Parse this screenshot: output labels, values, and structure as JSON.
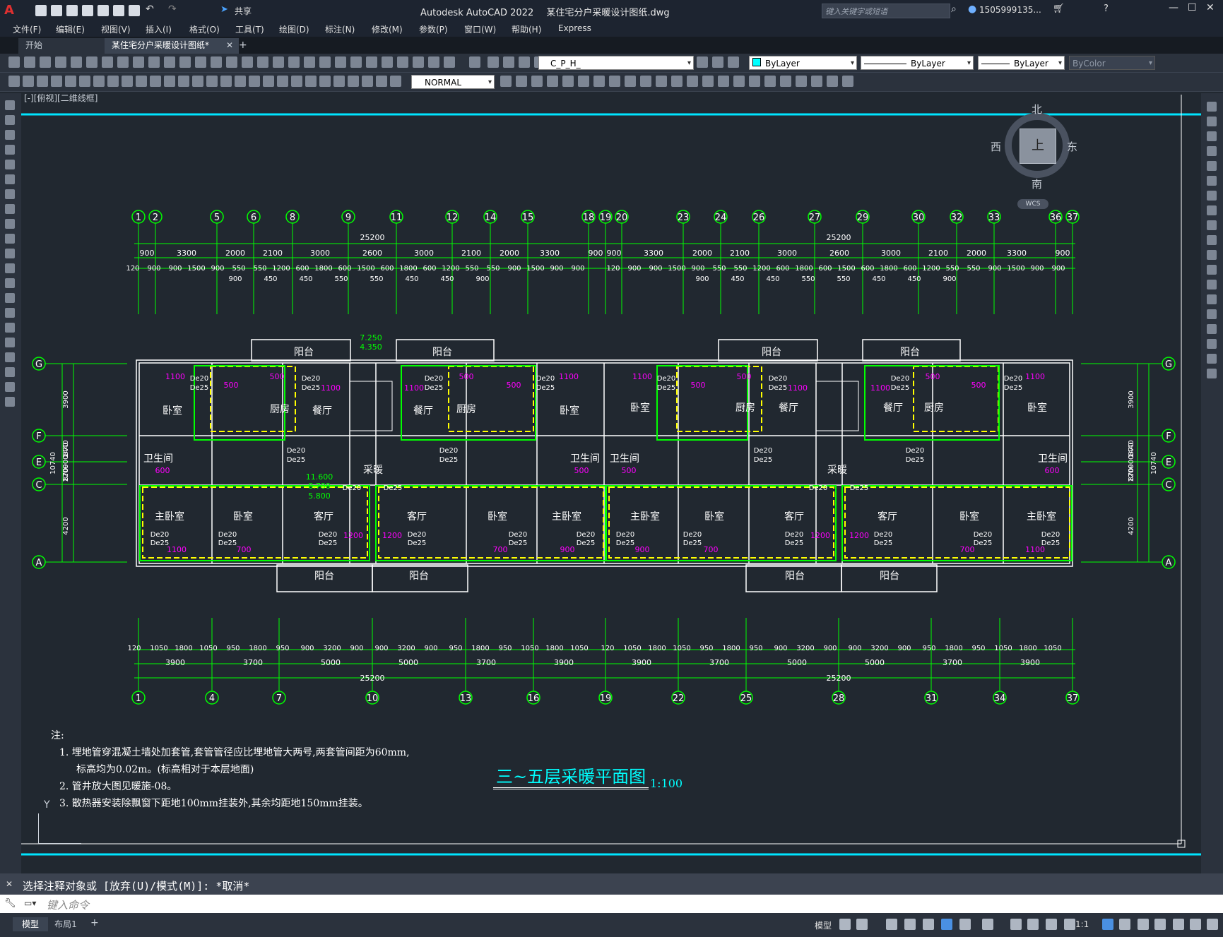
{
  "window": {
    "app_title": "Autodesk AutoCAD 2022",
    "file_title": "某住宅分户采暖设计图纸.dwg",
    "search_placeholder": "键入关键字或短语",
    "user": "1505999135...",
    "share_label": "共享"
  },
  "menu": [
    "文件(F)",
    "编辑(E)",
    "视图(V)",
    "插入(I)",
    "格式(O)",
    "工具(T)",
    "绘图(D)",
    "标注(N)",
    "修改(M)",
    "参数(P)",
    "窗口(W)",
    "帮助(H)",
    "Express"
  ],
  "tabs": {
    "start": "开始",
    "drawing": "某住宅分户采暖设计图纸*",
    "close": "✕",
    "new": "+"
  },
  "toolbar": {
    "layer": "C_P_H_",
    "color": "ByLayer",
    "linetype": "ByLayer",
    "lineweight": "ByLayer",
    "plotstyle": "ByColor",
    "textstyle": "NORMAL"
  },
  "viewport_label": "[-][俯视][二维线框]",
  "viewcube": {
    "north": "北",
    "south": "南",
    "east": "东",
    "west": "西",
    "top": "上",
    "wcs": "WCS"
  },
  "drawing": {
    "grid_top": [
      "1",
      "2",
      "5",
      "6",
      "8",
      "9",
      "11",
      "12",
      "14",
      "15",
      "18",
      "19",
      "20",
      "23",
      "24",
      "26",
      "27",
      "29",
      "30",
      "32",
      "33",
      "36",
      "37"
    ],
    "grid_bottom": [
      "1",
      "4",
      "7",
      "10",
      "13",
      "16",
      "19",
      "22",
      "25",
      "28",
      "31",
      "34",
      "37"
    ],
    "grid_side": [
      "G",
      "F",
      "E",
      "C",
      "A"
    ],
    "dim_total": "25200",
    "dims_row1_left": [
      "900",
      "3300",
      "2000",
      "2100",
      "3000",
      "2600",
      "3000",
      "2100",
      "2000",
      "3300",
      "900"
    ],
    "dims_row1_right": [
      "900",
      "3300",
      "2000",
      "2100",
      "3000",
      "2600",
      "3000",
      "2100",
      "2000",
      "3300",
      "900"
    ],
    "dims_row2": [
      "120",
      "900",
      "900",
      "1500",
      "900",
      "550",
      "550",
      "1200",
      "600",
      "1800",
      "600",
      "1500",
      "600",
      "1800",
      "600",
      "1200",
      "550",
      "550",
      "900",
      "1500",
      "900",
      "900"
    ],
    "dims_row3": [
      "900",
      "450",
      "450",
      "550",
      "550",
      "450",
      "450",
      "900"
    ],
    "dims_bottom_row1": [
      "120",
      "1050",
      "1800",
      "1050",
      "950",
      "1800",
      "950",
      "900",
      "3200",
      "900",
      "900",
      "3200",
      "900",
      "950",
      "1800",
      "950",
      "1050",
      "1800",
      "1050"
    ],
    "dims_bottom_row2": [
      "3900",
      "3700",
      "5000",
      "5000",
      "3700",
      "3900",
      "3900",
      "3700",
      "5000",
      "5000",
      "3700",
      "3900"
    ],
    "dims_side_left": [
      "3900",
      "1440",
      "1200",
      "4200",
      "870",
      "900",
      "870",
      "10740"
    ],
    "dims_side_right": [
      "3900",
      "1440",
      "1200",
      "4200",
      "870",
      "900",
      "870",
      "10740"
    ],
    "rooms": {
      "balcony": "阳台",
      "bedroom": "卧室",
      "kitchen": "厨房",
      "dining": "餐厅",
      "bath": "卫生间",
      "master": "主卧室",
      "living": "客厅",
      "heating": "采暖"
    },
    "levels": [
      "7.250",
      "4.350",
      "11.600",
      "8.700",
      "5.800"
    ],
    "pipe_labels": [
      "De20",
      "De25"
    ],
    "radiator_values": [
      "1100",
      "500",
      "1200",
      "700",
      "900",
      "600"
    ],
    "notes_title": "注:",
    "notes": [
      "1. 埋地管穿混凝土墙处加套管,套管管径应比埋地管大两号,两套管间距为60mm,",
      "标高均为0.02m。(标高相对于本层地面)",
      "2. 管井放大图见暖施-08。",
      "3. 散热器安装除飘窗下距地100mm挂装外,其余均距地150mm挂装。"
    ],
    "plan_title": "三~五层采暖平面图",
    "scale": "1:100",
    "ucs_y": "Y"
  },
  "command": {
    "history": "选择注释对象或 [放弃(U)/模式(M)]: *取消*",
    "placeholder": "键入命令"
  },
  "layout_tabs": {
    "model": "模型",
    "layout1": "布局1",
    "add": "+"
  },
  "status": {
    "model": "模型",
    "scale": "1:1"
  }
}
